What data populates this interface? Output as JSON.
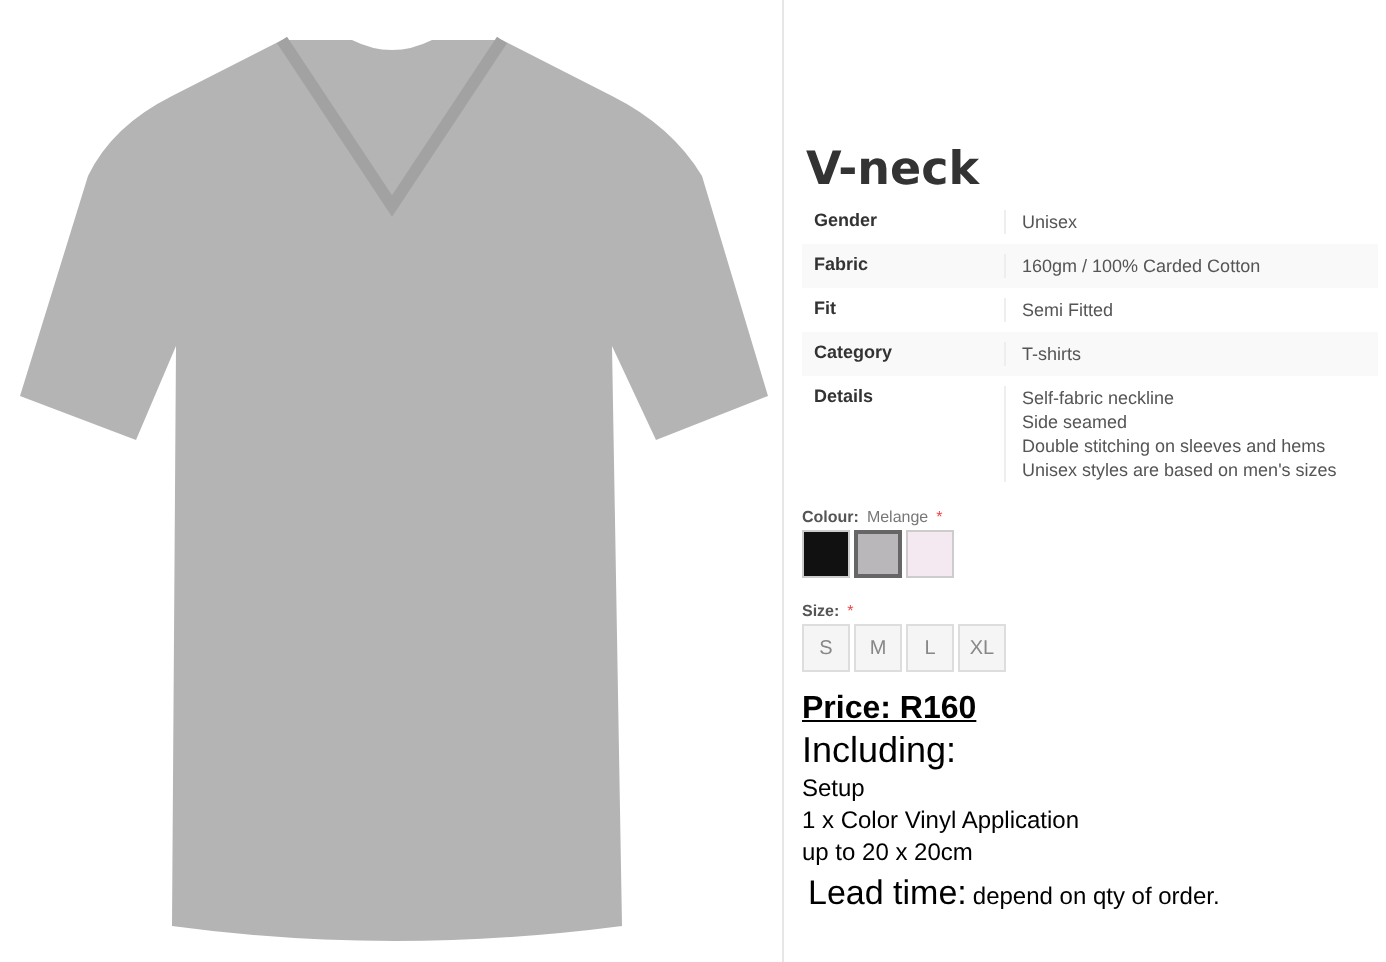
{
  "product": {
    "title": "V-neck",
    "specs": [
      {
        "label": "Gender",
        "value": [
          "Unisex"
        ]
      },
      {
        "label": "Fabric",
        "value": [
          "160gm / 100% Carded Cotton"
        ]
      },
      {
        "label": "Fit",
        "value": [
          "Semi Fitted"
        ]
      },
      {
        "label": "Category",
        "value": [
          "T-shirts"
        ]
      },
      {
        "label": "Details",
        "value": [
          "Self-fabric neckline",
          "Side seamed",
          "Double stitching on sleeves and hems",
          "Unisex styles are based on men's sizes"
        ]
      }
    ],
    "colour": {
      "label": "Colour:",
      "chosen": "Melange",
      "required": "*",
      "swatches": [
        {
          "color": "#111111",
          "selected": false
        },
        {
          "color": "#b9b7b9",
          "selected": true
        },
        {
          "color": "#f4e9f0",
          "selected": false
        }
      ]
    },
    "size": {
      "label": "Size:",
      "required": "*",
      "options": [
        {
          "label": "S",
          "selected": false
        },
        {
          "label": "M",
          "selected": false
        },
        {
          "label": "L",
          "selected": false
        },
        {
          "label": "XL",
          "selected": false
        }
      ]
    },
    "price": "Price: R160",
    "including": "Including:",
    "inclusions": [
      "Setup",
      "1 x Color Vinyl Application",
      "up to 20 x 20cm"
    ],
    "lead_time": {
      "label": "Lead time:",
      "value": "depend  on qty of order."
    }
  }
}
